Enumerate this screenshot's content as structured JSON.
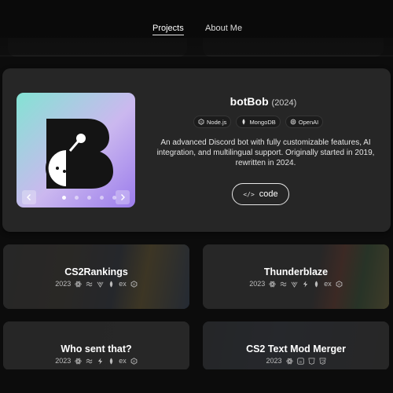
{
  "nav": {
    "projects": "Projects",
    "about": "About Me"
  },
  "featured": {
    "title": "botBob",
    "year": "(2024)",
    "tags": [
      {
        "label": "Node.js",
        "icon": "nodejs-icon"
      },
      {
        "label": "MongoDB",
        "icon": "mongodb-leaf-icon"
      },
      {
        "label": "OpenAI",
        "icon": "openai-icon"
      }
    ],
    "description": "An advanced Discord bot with fully customizable features, AI integration, and multilingual support. Originally started in 2019, rewritten in 2024.",
    "code_button": {
      "icon": "</>",
      "label": "code"
    },
    "carousel": {
      "slides": 5,
      "active": 0
    }
  },
  "projects": [
    {
      "title": "CS2Rankings",
      "year": "2023",
      "icons": [
        "react-icon",
        "tailwind-icon",
        "vite-icon",
        "mongodb-leaf-icon",
        "express-icon",
        "nodejs-icon"
      ]
    },
    {
      "title": "Thunderblaze",
      "year": "2023",
      "icons": [
        "react-icon",
        "tailwind-icon",
        "vite-icon",
        "thunder-icon",
        "mongodb-leaf-icon",
        "express-icon",
        "nodejs-icon"
      ]
    },
    {
      "title": "Who sent that?",
      "year": "2023",
      "icons": [
        "react-icon",
        "tailwind-icon",
        "thunder-icon",
        "mongodb-leaf-icon",
        "express-icon",
        "nodejs-icon"
      ]
    },
    {
      "title": "CS2 Text Mod Merger",
      "year": "2023",
      "icons": [
        "react-icon",
        "js-icon",
        "html-icon",
        "css-icon"
      ]
    }
  ],
  "colors": {
    "background": "#0c0c0c",
    "panel": "#262626",
    "accent_gradient": [
      "#83e3d3",
      "#cbb8ef",
      "#9b7cec"
    ],
    "logo": "#141414"
  }
}
